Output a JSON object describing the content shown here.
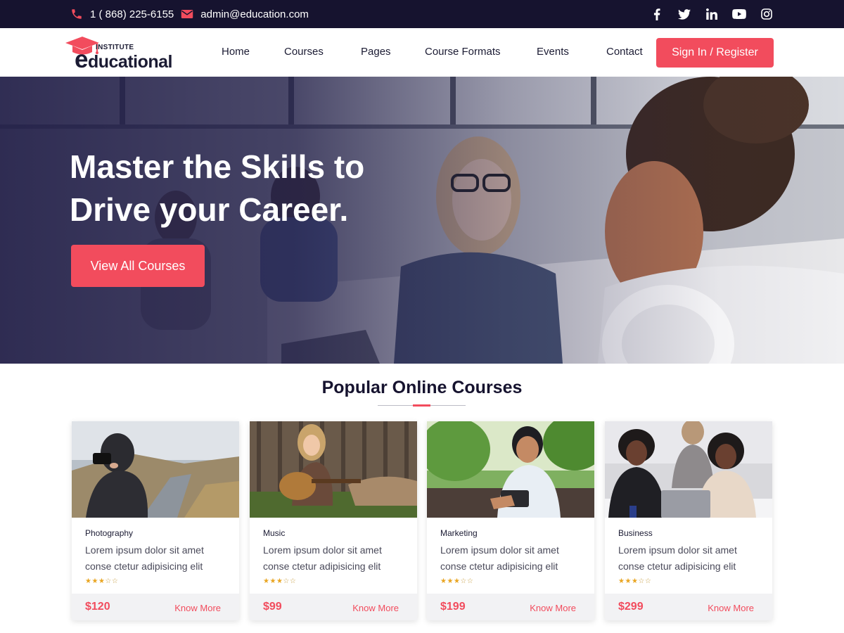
{
  "topbar": {
    "phone": "1 ( 868) 225-6155",
    "email": "admin@education.com",
    "social_icons": [
      "facebook-icon",
      "twitter-icon",
      "linkedin-icon",
      "youtube-icon",
      "instagram-icon"
    ]
  },
  "header": {
    "logo_small": "INSTITUTE",
    "logo_first": "e",
    "logo_rest": "ducational",
    "nav": [
      "Home",
      "Courses",
      "Pages",
      "Course Formats",
      "Events",
      "Contact"
    ],
    "signin_label": "Sign In / Register"
  },
  "hero": {
    "line1": "Master the Skills to",
    "line2": "Drive your Career.",
    "cta_label": "View All Courses"
  },
  "section": {
    "title": "Popular Online Courses"
  },
  "courses": [
    {
      "category": "Photography",
      "line1": "Lorem ipsum dolor sit amet",
      "line2": "conse ctetur adipisicing elit",
      "rating": 3,
      "price": "$120",
      "more": "Know More"
    },
    {
      "category": "Music",
      "line1": "Lorem ipsum dolor sit amet",
      "line2": "conse ctetur adipisicing elit",
      "rating": 3,
      "price": "$99",
      "more": "Know More"
    },
    {
      "category": "Marketing",
      "line1": "Lorem ipsum dolor sit amet",
      "line2": "conse ctetur adipisicing elit",
      "rating": 3,
      "price": "$199",
      "more": "Know More"
    },
    {
      "category": "Business",
      "line1": "Lorem ipsum dolor sit amet",
      "line2": "conse ctetur adipisicing elit",
      "rating": 3,
      "price": "$299",
      "more": "Know More"
    }
  ],
  "colors": {
    "accent": "#f24c5d",
    "dark": "#16132f",
    "star": "#e9a520"
  }
}
